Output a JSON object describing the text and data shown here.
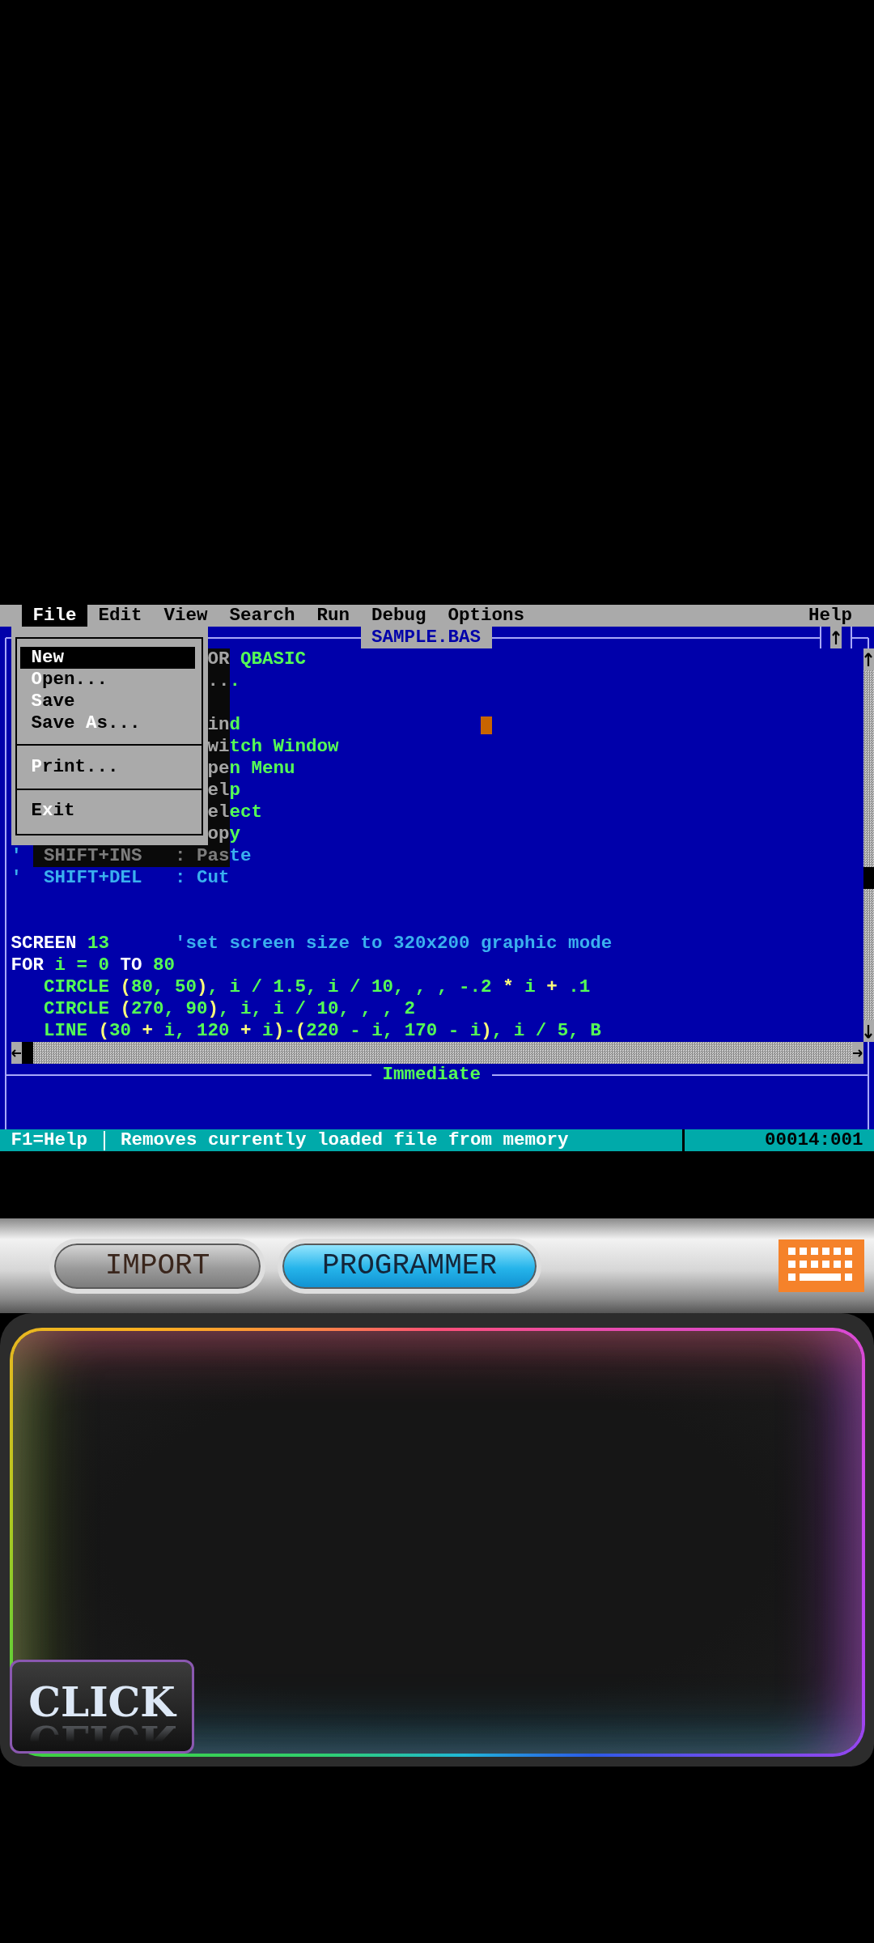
{
  "menu_bar": {
    "items": [
      {
        "label": "File",
        "selected": true
      },
      {
        "label": "Edit",
        "selected": false
      },
      {
        "label": "View",
        "selected": false
      },
      {
        "label": "Search",
        "selected": false
      },
      {
        "label": "Run",
        "selected": false
      },
      {
        "label": "Debug",
        "selected": false
      },
      {
        "label": "Options",
        "selected": false
      },
      {
        "label": "Help",
        "selected": false
      }
    ]
  },
  "editor": {
    "title": "SAMPLE.BAS",
    "blocks": [
      {
        "lines": [
          {
            "segments": [
              {
                "kind": "code",
                "text": "                  OR QBASIC"
              }
            ]
          },
          {
            "segments": [
              {
                "kind": "code",
                "text": "                  ..."
              }
            ]
          }
        ]
      },
      {
        "lines": [
          {
            "segments": [
              {
                "kind": "code",
                "text": "                  ind                      "
              },
              {
                "kind": "cursor"
              }
            ]
          },
          {
            "segments": [
              {
                "kind": "code",
                "text": "                  witch Window"
              }
            ]
          },
          {
            "segments": [
              {
                "kind": "code",
                "text": "                  pen Menu"
              }
            ]
          },
          {
            "segments": [
              {
                "kind": "code",
                "text": "                  elp"
              }
            ]
          },
          {
            "segments": [
              {
                "kind": "code",
                "text": "                  elect"
              }
            ]
          },
          {
            "segments": [
              {
                "kind": "code",
                "text": "                  opy"
              }
            ]
          },
          {
            "segments": [
              {
                "kind": "comment",
                "text": "'  SHIFT+INS   : Paste"
              }
            ]
          },
          {
            "segments": [
              {
                "kind": "comment",
                "text": "'  SHIFT+DEL   : Cut"
              }
            ]
          }
        ]
      },
      {
        "lines": [
          {
            "segments": [
              {
                "kind": "keyword",
                "text": "SCREEN"
              },
              {
                "kind": "code",
                "text": " 13"
              },
              {
                "kind": "comment",
                "text": "      'set screen size to 320x200 graphic mode"
              }
            ]
          },
          {
            "segments": [
              {
                "kind": "keyword",
                "text": "FOR"
              },
              {
                "kind": "code",
                "text": " i = 0 "
              },
              {
                "kind": "keyword",
                "text": "TO"
              },
              {
                "kind": "code",
                "text": " 80"
              }
            ]
          },
          {
            "segments": [
              {
                "kind": "code",
                "text": "   CIRCLE "
              },
              {
                "kind": "symbol",
                "text": "("
              },
              {
                "kind": "code",
                "text": "80, 50"
              },
              {
                "kind": "symbol",
                "text": ")"
              },
              {
                "kind": "code",
                "text": ", i / 1.5, i / 10, , , -.2 "
              },
              {
                "kind": "symbol",
                "text": "*"
              },
              {
                "kind": "code",
                "text": " i "
              },
              {
                "kind": "symbol",
                "text": "+"
              },
              {
                "kind": "code",
                "text": " .1"
              }
            ]
          },
          {
            "segments": [
              {
                "kind": "code",
                "text": "   CIRCLE "
              },
              {
                "kind": "symbol",
                "text": "("
              },
              {
                "kind": "code",
                "text": "270, 90"
              },
              {
                "kind": "symbol",
                "text": ")"
              },
              {
                "kind": "code",
                "text": ", i, i / 10, , , 2"
              }
            ]
          },
          {
            "segments": [
              {
                "kind": "code",
                "text": "   LINE "
              },
              {
                "kind": "symbol",
                "text": "("
              },
              {
                "kind": "code",
                "text": "30 "
              },
              {
                "kind": "symbol",
                "text": "+"
              },
              {
                "kind": "code",
                "text": " i, 120 "
              },
              {
                "kind": "symbol",
                "text": "+"
              },
              {
                "kind": "code",
                "text": " i"
              },
              {
                "kind": "symbol",
                "text": ")"
              },
              {
                "kind": "code",
                "text": "-"
              },
              {
                "kind": "symbol",
                "text": "("
              },
              {
                "kind": "code",
                "text": "220 - i, 170 - i"
              },
              {
                "kind": "symbol",
                "text": ")"
              },
              {
                "kind": "code",
                "text": ", i / 5, B"
              }
            ]
          }
        ]
      }
    ]
  },
  "file_menu": {
    "groups": [
      {
        "items": [
          {
            "label": "**N**ew",
            "selected": true
          },
          {
            "label": "**O**pen...",
            "selected": false
          },
          {
            "label": "**S**ave",
            "selected": false
          },
          {
            "label": "Save **A**s...",
            "selected": false
          }
        ]
      },
      {
        "items": [
          {
            "label": "**P**rint...",
            "selected": false
          }
        ]
      },
      {
        "items": [
          {
            "label": "E**x**it",
            "selected": false
          }
        ]
      }
    ]
  },
  "immediate": {
    "title": "Immediate"
  },
  "status_bar": {
    "help": "F1=Help",
    "message": "Removes currently loaded file from memory",
    "position": "00014:001"
  },
  "mode_buttons": [
    {
      "label": "IMPORT",
      "selected": false
    },
    {
      "label": "PROGRAMMER",
      "selected": true
    }
  ],
  "click_button": {
    "label": "CLICK"
  }
}
